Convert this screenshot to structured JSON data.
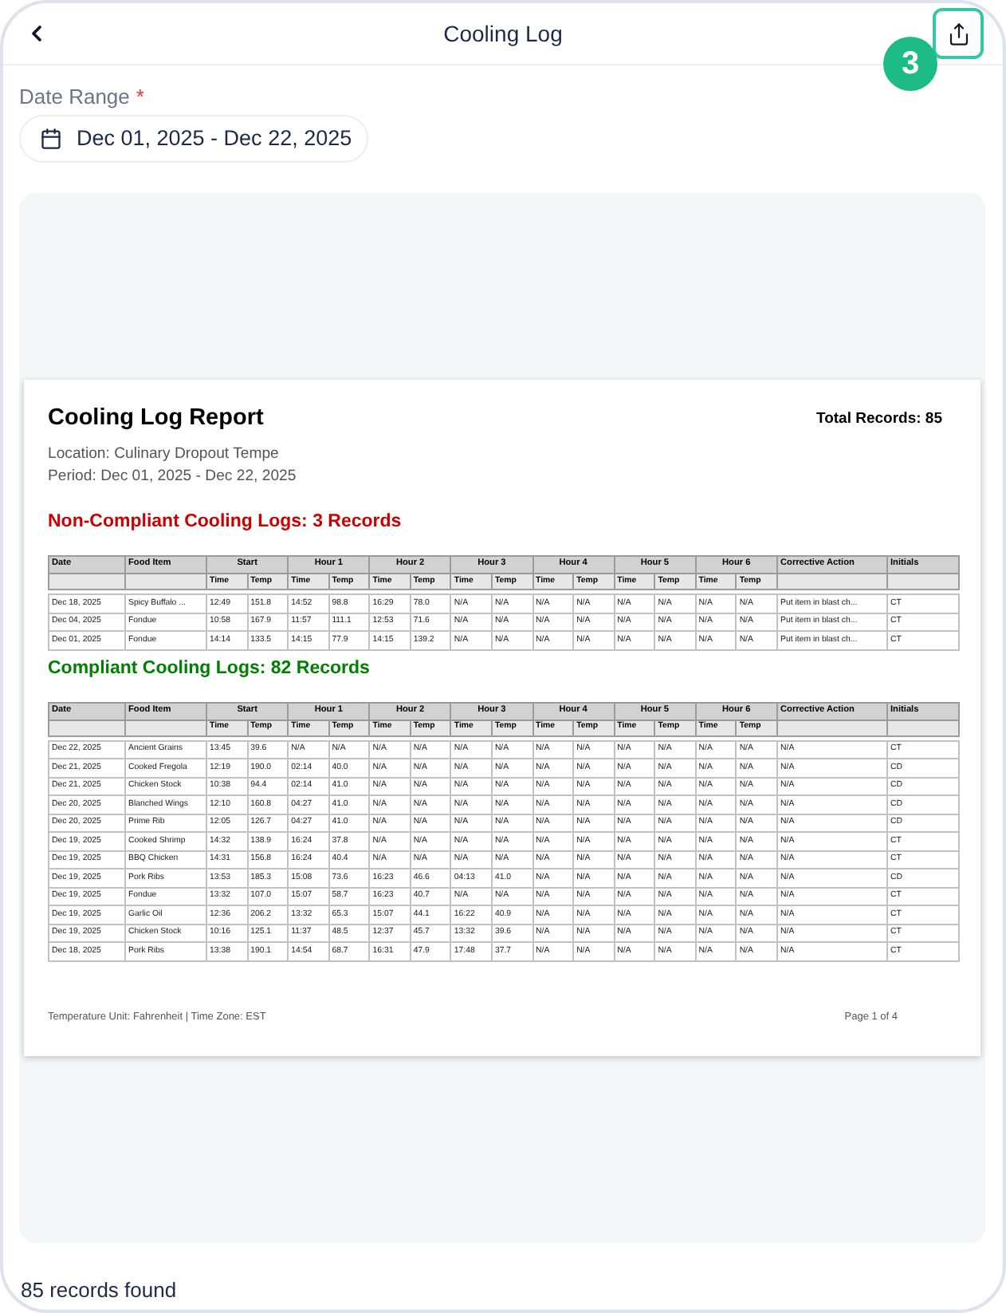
{
  "header": {
    "title": "Cooling Log",
    "badge": "3"
  },
  "date_range": {
    "label": "Date Range",
    "required_mark": "*",
    "value": "Dec 01, 2025 - Dec 22, 2025"
  },
  "report": {
    "title": "Cooling Log Report",
    "total": "Total Records: 85",
    "location": "Location: Culinary Dropout Tempe",
    "period": "Period: Dec 01, 2025 - Dec 22, 2025",
    "sections": [
      {
        "heading": "Non-Compliant Cooling Logs: 3 Records",
        "color": "#cc0000",
        "columns": [
          {
            "label": "Date"
          },
          {
            "label": "Food Item"
          },
          {
            "label": "Start",
            "colspan": 2,
            "subcolumns": [
              "Time",
              "Temp"
            ]
          },
          {
            "label": "Hour 1",
            "colspan": 2,
            "subcolumns": [
              "Time",
              "Temp"
            ]
          },
          {
            "label": "Hour 2",
            "colspan": 2,
            "subcolumns": [
              "Time",
              "Temp"
            ]
          },
          {
            "label": "Hour 3",
            "colspan": 2,
            "subcolumns": [
              "Time",
              "Temp"
            ]
          },
          {
            "label": "Hour 4",
            "colspan": 2,
            "subcolumns": [
              "Time",
              "Temp"
            ]
          },
          {
            "label": "Hour 5",
            "colspan": 2,
            "subcolumns": [
              "Time",
              "Temp"
            ]
          },
          {
            "label": "Hour 6",
            "colspan": 2,
            "subcolumns": [
              "Time",
              "Temp"
            ]
          },
          {
            "label": "Corrective Action"
          },
          {
            "label": "Initials"
          }
        ],
        "rows": [
          [
            "Dec 18, 2025",
            "Spicy Buffalo ...",
            "12:49",
            "151.8",
            "14:52",
            "98.8",
            "16:29",
            "78.0",
            "N/A",
            "N/A",
            "N/A",
            "N/A",
            "N/A",
            "N/A",
            "N/A",
            "N/A",
            "Put item in blast ch...",
            "CT"
          ],
          [
            "Dec 04, 2025",
            "Fondue",
            "10:58",
            "167.9",
            "11:57",
            "111.1",
            "12:53",
            "71.6",
            "N/A",
            "N/A",
            "N/A",
            "N/A",
            "N/A",
            "N/A",
            "N/A",
            "N/A",
            "Put item in blast ch...",
            "CT"
          ],
          [
            "Dec 01, 2025",
            "Fondue",
            "14:14",
            "133.5",
            "14:15",
            "77.9",
            "14:15",
            "139.2",
            "N/A",
            "N/A",
            "N/A",
            "N/A",
            "N/A",
            "N/A",
            "N/A",
            "N/A",
            "Put item in blast ch...",
            "CT"
          ]
        ]
      },
      {
        "heading": "Compliant Cooling Logs: 82 Records",
        "color": "#008000",
        "columns": [
          {
            "label": "Date"
          },
          {
            "label": "Food Item"
          },
          {
            "label": "Start",
            "colspan": 2,
            "subcolumns": [
              "Time",
              "Temp"
            ]
          },
          {
            "label": "Hour 1",
            "colspan": 2,
            "subcolumns": [
              "Time",
              "Temp"
            ]
          },
          {
            "label": "Hour 2",
            "colspan": 2,
            "subcolumns": [
              "Time",
              "Temp"
            ]
          },
          {
            "label": "Hour 3",
            "colspan": 2,
            "subcolumns": [
              "Time",
              "Temp"
            ]
          },
          {
            "label": "Hour 4",
            "colspan": 2,
            "subcolumns": [
              "Time",
              "Temp"
            ]
          },
          {
            "label": "Hour 5",
            "colspan": 2,
            "subcolumns": [
              "Time",
              "Temp"
            ]
          },
          {
            "label": "Hour 6",
            "colspan": 2,
            "subcolumns": [
              "Time",
              "Temp"
            ]
          },
          {
            "label": "Corrective Action"
          },
          {
            "label": "Initials"
          }
        ],
        "rows": [
          [
            "Dec 22, 2025",
            "Ancient Grains",
            "13:45",
            "39.6",
            "N/A",
            "N/A",
            "N/A",
            "N/A",
            "N/A",
            "N/A",
            "N/A",
            "N/A",
            "N/A",
            "N/A",
            "N/A",
            "N/A",
            "N/A",
            "CT"
          ],
          [
            "Dec 21, 2025",
            "Cooked Fregola",
            "12:19",
            "190.0",
            "02:14",
            "40.0",
            "N/A",
            "N/A",
            "N/A",
            "N/A",
            "N/A",
            "N/A",
            "N/A",
            "N/A",
            "N/A",
            "N/A",
            "N/A",
            "CD"
          ],
          [
            "Dec 21, 2025",
            "Chicken Stock",
            "10:38",
            "94.4",
            "02:14",
            "41.0",
            "N/A",
            "N/A",
            "N/A",
            "N/A",
            "N/A",
            "N/A",
            "N/A",
            "N/A",
            "N/A",
            "N/A",
            "N/A",
            "CD"
          ],
          [
            "Dec 20, 2025",
            "Blanched Wings",
            "12:10",
            "160.8",
            "04:27",
            "41.0",
            "N/A",
            "N/A",
            "N/A",
            "N/A",
            "N/A",
            "N/A",
            "N/A",
            "N/A",
            "N/A",
            "N/A",
            "N/A",
            "CD"
          ],
          [
            "Dec 20, 2025",
            "Prime Rib",
            "12:05",
            "126.7",
            "04:27",
            "41.0",
            "N/A",
            "N/A",
            "N/A",
            "N/A",
            "N/A",
            "N/A",
            "N/A",
            "N/A",
            "N/A",
            "N/A",
            "N/A",
            "CD"
          ],
          [
            "Dec 19, 2025",
            "Cooked Shrimp",
            "14:32",
            "138.9",
            "16:24",
            "37.8",
            "N/A",
            "N/A",
            "N/A",
            "N/A",
            "N/A",
            "N/A",
            "N/A",
            "N/A",
            "N/A",
            "N/A",
            "N/A",
            "CT"
          ],
          [
            "Dec 19, 2025",
            "BBQ Chicken",
            "14:31",
            "156.8",
            "16:24",
            "40.4",
            "N/A",
            "N/A",
            "N/A",
            "N/A",
            "N/A",
            "N/A",
            "N/A",
            "N/A",
            "N/A",
            "N/A",
            "N/A",
            "CT"
          ],
          [
            "Dec 19, 2025",
            "Pork Ribs",
            "13:53",
            "185.3",
            "15:08",
            "73.6",
            "16:23",
            "46.6",
            "04:13",
            "41.0",
            "N/A",
            "N/A",
            "N/A",
            "N/A",
            "N/A",
            "N/A",
            "N/A",
            "CD"
          ],
          [
            "Dec 19, 2025",
            "Fondue",
            "13:32",
            "107.0",
            "15:07",
            "58.7",
            "16:23",
            "40.7",
            "N/A",
            "N/A",
            "N/A",
            "N/A",
            "N/A",
            "N/A",
            "N/A",
            "N/A",
            "N/A",
            "CT"
          ],
          [
            "Dec 19, 2025",
            "Garlic Oil",
            "12:36",
            "206.2",
            "13:32",
            "65.3",
            "15:07",
            "44.1",
            "16:22",
            "40.9",
            "N/A",
            "N/A",
            "N/A",
            "N/A",
            "N/A",
            "N/A",
            "N/A",
            "CT"
          ],
          [
            "Dec 19, 2025",
            "Chicken Stock",
            "10:16",
            "125.1",
            "11:37",
            "48.5",
            "12:37",
            "45.7",
            "13:32",
            "39.6",
            "N/A",
            "N/A",
            "N/A",
            "N/A",
            "N/A",
            "N/A",
            "N/A",
            "CT"
          ],
          [
            "Dec 18, 2025",
            "Pork Ribs",
            "13:38",
            "190.1",
            "14:54",
            "68.7",
            "16:31",
            "47.9",
            "17:48",
            "37.7",
            "N/A",
            "N/A",
            "N/A",
            "N/A",
            "N/A",
            "N/A",
            "N/A",
            "CT"
          ]
        ]
      }
    ],
    "footer": {
      "left": "Temperature Unit: Fahrenheit | Time Zone: EST",
      "right": "Page 1 of 4"
    }
  },
  "status": "85 records found"
}
